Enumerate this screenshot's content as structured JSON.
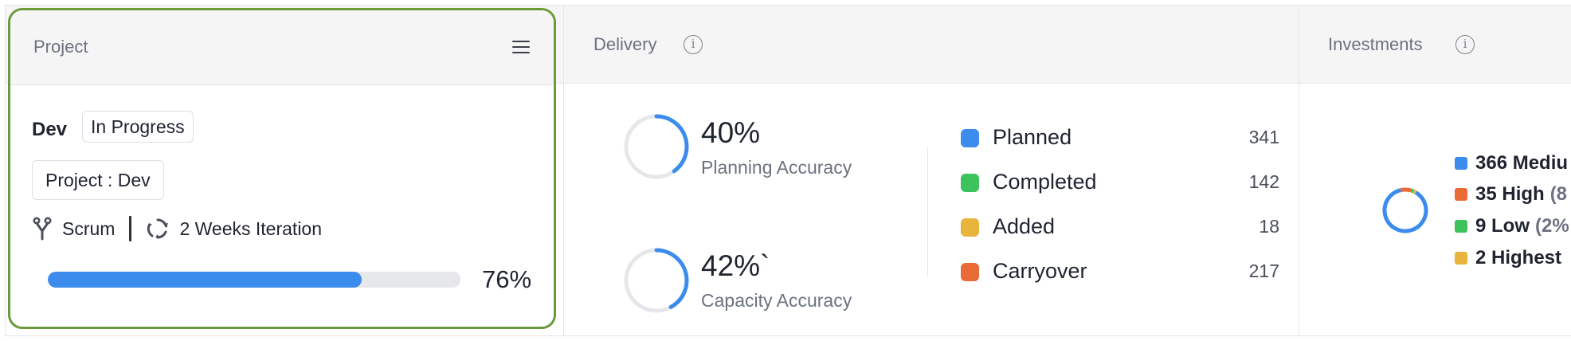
{
  "project": {
    "header_title": "Project",
    "name": "Dev",
    "status": "In Progress",
    "tag": "Project : Dev",
    "methodology": "Scrum",
    "iteration": "2 Weeks Iteration",
    "progress_percent": 76,
    "progress_label": "76%"
  },
  "delivery": {
    "header_title": "Delivery",
    "planning_accuracy": {
      "percent": 40,
      "value_label": "40%",
      "label": "Planning Accuracy"
    },
    "capacity_accuracy": {
      "percent": 42,
      "value_label": "42%`",
      "label": "Capacity Accuracy"
    },
    "legend": [
      {
        "label": "Planned",
        "count": "341",
        "color": "#3b8ced"
      },
      {
        "label": "Completed",
        "count": "142",
        "color": "#3cc35e"
      },
      {
        "label": "Added",
        "count": "18",
        "color": "#e8b43c"
      },
      {
        "label": "Carryover",
        "count": "217",
        "color": "#ea6a36"
      }
    ]
  },
  "investments": {
    "header_title": "Investments",
    "items": [
      {
        "text": "366 Mediu",
        "pct": "",
        "color": "#3b8ced",
        "share": 88
      },
      {
        "text": "35 High",
        "pct": "(8",
        "color": "#ea6a36",
        "share": 8
      },
      {
        "text": "9 Low",
        "pct": "(2%",
        "color": "#3cc35e",
        "share": 2
      },
      {
        "text": "2 Highest",
        "pct": "",
        "color": "#e8b43c",
        "share": 2
      }
    ]
  },
  "colors": {
    "ring_track": "#e6e7eb",
    "ring_fill": "#3b8ced",
    "card_border": "#6a9a3a",
    "progress_fill": "#3b8ced"
  }
}
